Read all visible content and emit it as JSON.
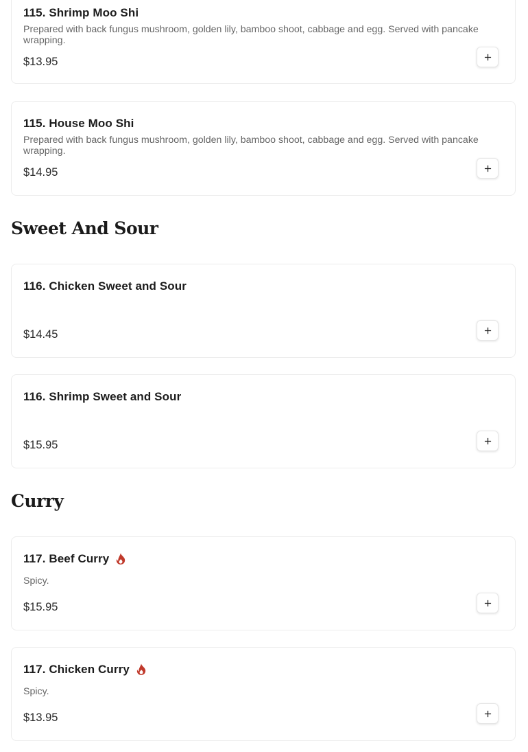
{
  "sections": [
    {
      "items": [
        {
          "name": "115. Shrimp Moo Shi",
          "desc": "Prepared with back fungus mushroom, golden lily, bamboo shoot, cabbage and egg. Served with pancake wrapping.",
          "price": "$13.95"
        },
        {
          "name": "115. House Moo Shi",
          "desc": "Prepared with back fungus mushroom, golden lily, bamboo shoot, cabbage and egg. Served with pancake wrapping.",
          "price": "$14.95"
        }
      ]
    },
    {
      "title": "Sweet And Sour",
      "items": [
        {
          "name": "116. Chicken Sweet and Sour",
          "desc": "",
          "price": "$14.45"
        },
        {
          "name": "116. Shrimp Sweet and Sour",
          "desc": "",
          "price": "$15.95"
        }
      ]
    },
    {
      "title": "Curry",
      "items": [
        {
          "name": "117. Beef Curry",
          "desc": "Spicy.",
          "price": "$15.95",
          "icon": "spicy-flame-icon"
        },
        {
          "name": "117. Chicken Curry",
          "desc": "Spicy.",
          "price": "$13.95",
          "icon": "spicy-flame-icon"
        }
      ]
    }
  ],
  "colors": {
    "spicy": "#c0392b",
    "card_border": "#ececec",
    "desc_text": "#666666"
  },
  "icons": {
    "add_button": "plus-icon",
    "spicy": "spicy-flame-icon"
  }
}
